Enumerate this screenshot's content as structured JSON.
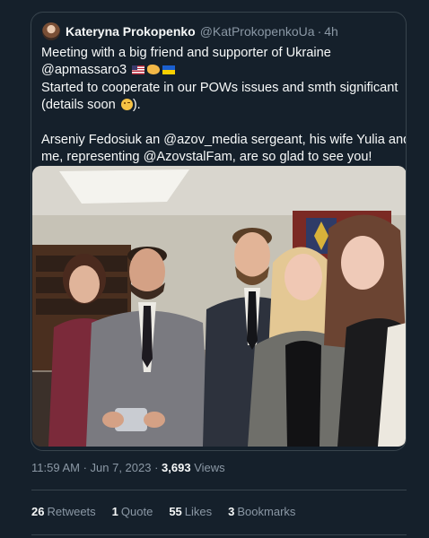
{
  "tweet": {
    "display_name": "Kateryna Prokopenko",
    "handle": "@KatProkopenkoUa",
    "separator": "·",
    "time_ago": "4h",
    "text_line1": "Meeting with a big friend and supporter of Ukraine",
    "text_line2": "@apmassaro3",
    "text_line3a": "Started to cooperate in our POWs issues and smth significant",
    "text_line3b": "(details soon",
    "text_line3c": ").",
    "text_line4": "Arseniy Fedosiuk an @azov_media sergeant, his wife Yulia and",
    "text_line5": "me, representing @AzovstalFam, are so glad to see you!",
    "emoji": [
      "us-flag-icon",
      "handshake-icon",
      "ukraine-flag-icon",
      "winking-face-icon"
    ]
  },
  "meta": {
    "timestamp": "11:59 AM · Jun 7, 2023 · ",
    "views_count": "3,693",
    "views_label": "Views"
  },
  "stats": {
    "retweets_count": "26",
    "retweets_label": "Retweets",
    "quotes_count": "1",
    "quotes_label": "Quote",
    "likes_count": "55",
    "likes_label": "Likes",
    "bookmarks_count": "3",
    "bookmarks_label": "Bookmarks"
  },
  "colors": {
    "background": "#15202b",
    "border": "#38444d",
    "text_primary": "#f7f9f9",
    "text_secondary": "#8b98a5"
  }
}
